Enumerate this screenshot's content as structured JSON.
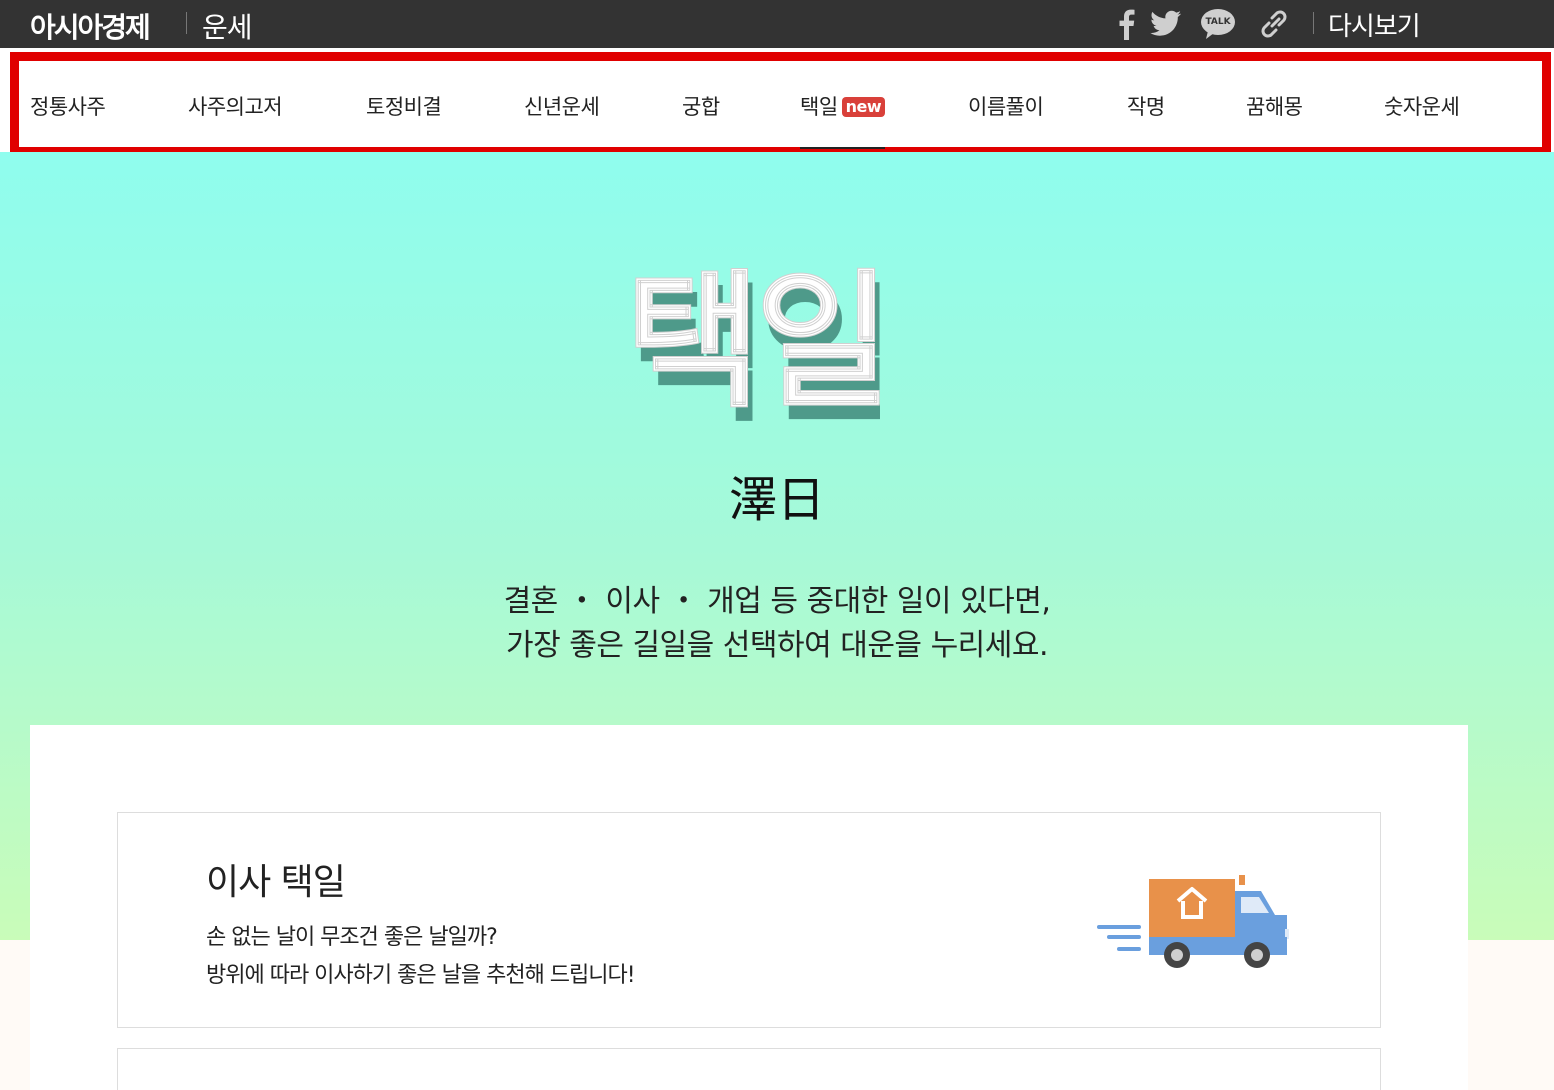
{
  "header": {
    "logo": "아시아경제",
    "section": "운세",
    "share_icons": [
      "facebook-icon",
      "twitter-icon",
      "kakaotalk-icon",
      "link-icon"
    ],
    "kakao_label": "TALK",
    "replay_label": "다시보기"
  },
  "nav": {
    "items": [
      {
        "label": "정통사주"
      },
      {
        "label": "사주의고저"
      },
      {
        "label": "토정비결"
      },
      {
        "label": "신년운세"
      },
      {
        "label": "궁합"
      },
      {
        "label": "택일",
        "badge": "new",
        "active": true
      },
      {
        "label": "이름풀이"
      },
      {
        "label": "작명"
      },
      {
        "label": "꿈해몽"
      },
      {
        "label": "숫자운세"
      }
    ]
  },
  "hero": {
    "title": "택일",
    "hanja": "澤日",
    "desc_line1": "결혼 ・ 이사 ・ 개업 등 중대한 일이 있다면,",
    "desc_line2": "가장 좋은 길일을 선택하여 대운을 누리세요."
  },
  "cards": [
    {
      "title": "이사 택일",
      "line1": "손 없는 날이 무조건 좋은 날일까?",
      "line2": "방위에 따라 이사하기 좋은 날을 추천해 드립니다!",
      "icon": "moving-truck-icon"
    }
  ],
  "colors": {
    "topbar": "#333333",
    "nav_outline": "#e00000",
    "badge": "#d9403a",
    "hero_top": "#8ffdee",
    "hero_bottom": "#c9fcb9",
    "truck_box": "#e8914a",
    "truck_cab": "#6a9fde"
  }
}
